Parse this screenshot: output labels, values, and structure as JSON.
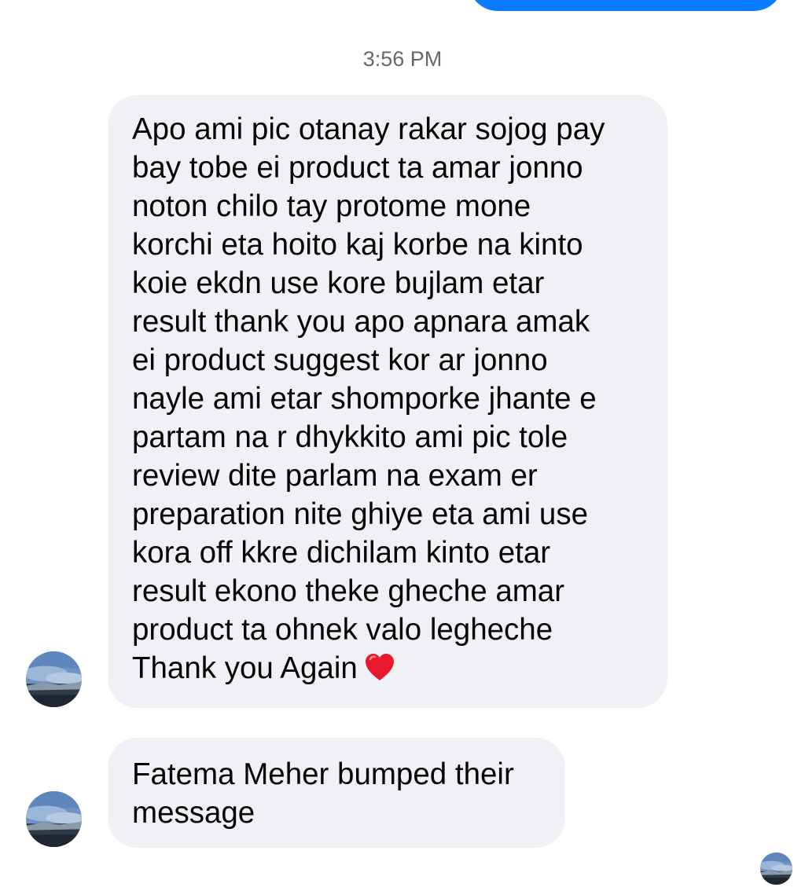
{
  "thread": {
    "timestamp": "3:56 PM",
    "messages": [
      {
        "lines": [
          "Apo ami pic otanay rakar sojog pay",
          "bay tobe ei product ta amar jonno",
          "noton chilo tay protome mone",
          "korchi eta hoito kaj korbe na kinto",
          "koie ekdn use kore bujlam etar",
          "result thank you apo apnara amak",
          "ei product suggest kor ar jonno",
          "nayle ami etar shomporke jhante e",
          "partam na r dhykkito ami pic tole",
          "review dite parlam na exam er",
          "preparation nite ghiye eta ami use",
          "kora off kkre dichilam kinto etar",
          "result ekono theke gheche amar",
          "product ta ohnek valo legheche",
          "Thank you Again"
        ],
        "emoji": "heart-emoji"
      },
      {
        "lines": [
          "Fatema Meher bumped their",
          "message"
        ]
      }
    ]
  },
  "colors": {
    "sent_bubble": "#0a7cff",
    "received_bubble": "#f0f1f5",
    "timestamp_text": "#65676b",
    "message_text": "#050505",
    "heart": "#e8192c"
  }
}
